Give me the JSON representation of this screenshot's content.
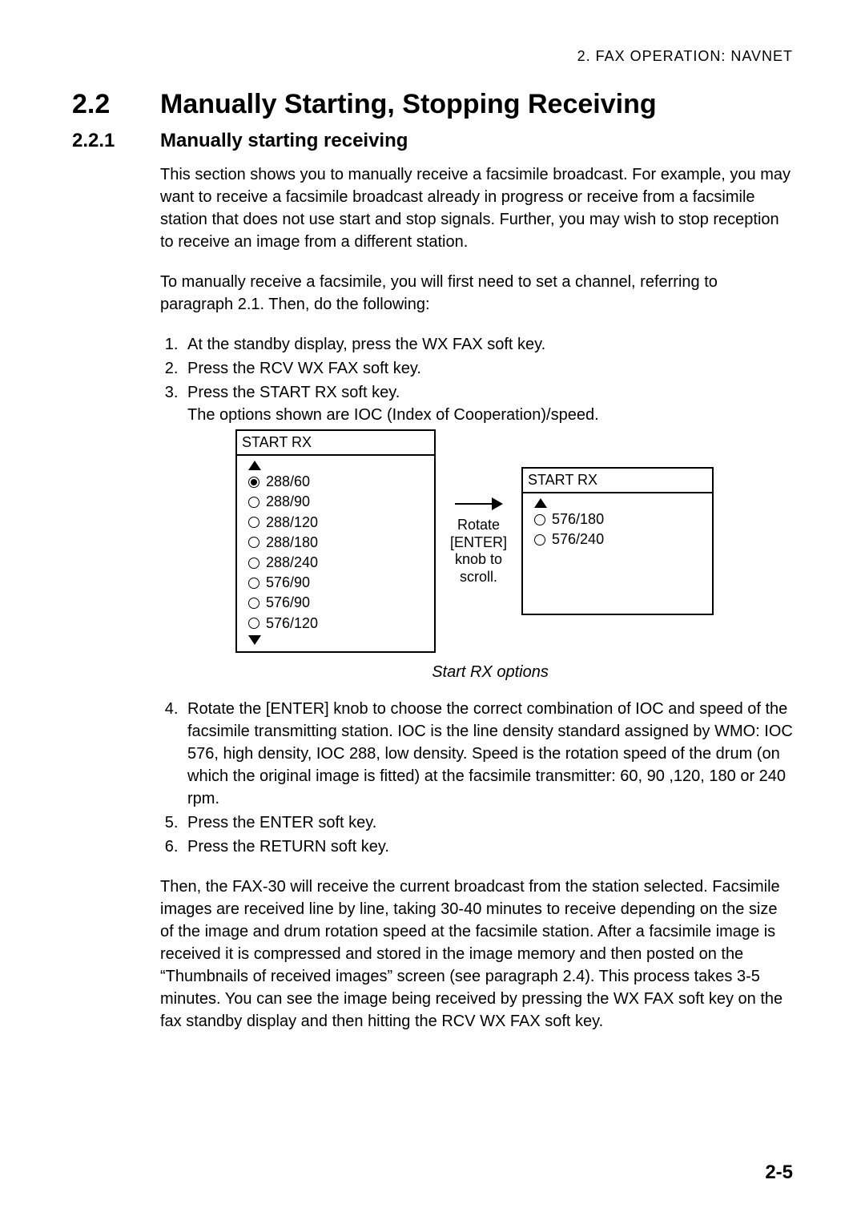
{
  "running_header": "2. FAX OPERATION: NAVNET",
  "section": {
    "number": "2.2",
    "title": "Manually Starting, Stopping Receiving"
  },
  "subsection": {
    "number": "2.2.1",
    "title": "Manually starting receiving"
  },
  "para1": "This section shows you to manually receive a facsimile broadcast. For example, you may want to receive a facsimile broadcast already in progress or receive from a facsimile station that does not use start and stop signals. Further, you may wish to stop reception to receive an image from a different station.",
  "para2": "To manually receive a facsimile, you will first need to set a channel, referring to paragraph 2.1. Then, do the following:",
  "steps_a": {
    "s1": "At the standby display, press the WX FAX soft key.",
    "s2": "Press the RCV WX FAX soft key.",
    "s3": "Press the START RX soft key.",
    "s3_sub": "The options shown are IOC (Index of Cooperation)/speed."
  },
  "figure": {
    "left_title": "START RX",
    "right_title": "START RX",
    "left_options": {
      "o0": "288/60",
      "o1": "288/90",
      "o2": "288/120",
      "o3": "288/180",
      "o4": "288/240",
      "o5": "576/90",
      "o6": "576/90",
      "o7": "576/120"
    },
    "right_options": {
      "o0": "576/180",
      "o1": "576/240"
    },
    "mid_l1": "Rotate",
    "mid_l2": "[ENTER]",
    "mid_l3": "knob to",
    "mid_l4": "scroll.",
    "caption": "Start RX options"
  },
  "steps_b": {
    "s4": "Rotate the [ENTER] knob to choose the correct combination of IOC and speed of the facsimile transmitting station. IOC is the line density standard assigned by WMO: IOC 576, high density, IOC 288, low density. Speed is the rotation speed of the drum (on which the original image is fitted) at the facsimile transmitter: 60, 90 ,120, 180 or 240 rpm.",
    "s5": "Press the ENTER soft key.",
    "s6": "Press the RETURN soft key."
  },
  "para3": "Then, the FAX-30 will receive the current broadcast from the station selected. Facsimile images are received line by line, taking 30-40 minutes to receive depending on the size of the image and drum rotation speed at the facsimile station. After a facsimile image is received it is compressed and stored in the image memory and then posted on the “Thumbnails of received images” screen (see paragraph 2.4). This process takes 3-5 minutes. You can see the image being received by pressing the WX FAX soft key on the fax standby display and then hitting the RCV WX FAX soft key.",
  "page_number": "2-5"
}
